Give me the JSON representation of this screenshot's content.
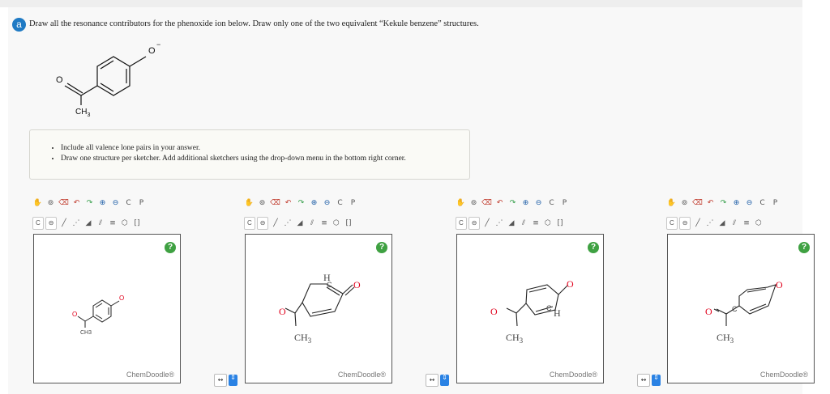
{
  "question": {
    "badge": "a",
    "text": "Draw all the resonance contributors for the phenoxide ion below. Draw only one of the two equivalent “Kekule benzene” structures."
  },
  "molecule_labels": {
    "oxide": "O",
    "charge": "−",
    "carbonyl_o": "O",
    "methyl": "CH3",
    "methyl_sub": "3",
    "methyl_base": "CH",
    "ring_h": "H",
    "ring_c": "C"
  },
  "instructions": [
    "Include all valence lone pairs in your answer.",
    "Draw one structure per sketcher. Add additional sketchers using the drop-down menu in the bottom right corner."
  ],
  "toolbar": {
    "element_select": "C",
    "charge_select": "⊖",
    "copy_label": "C",
    "paste_label": "P",
    "rings_label": "⬡",
    "extra_label": "[]"
  },
  "sketchers": [
    {
      "brand": "ChemDoodle®",
      "help": "?"
    },
    {
      "brand": "ChemDoodle®",
      "help": "?"
    },
    {
      "brand": "ChemDoodle®",
      "help": "?"
    },
    {
      "brand": "ChemDoodle®",
      "help": "?"
    }
  ],
  "switcher": {
    "arrows": "↔",
    "updown": "⇕"
  },
  "colors": {
    "accent": "#1f7ac4",
    "oxygen": "#e0001b",
    "help": "#3fa142"
  }
}
